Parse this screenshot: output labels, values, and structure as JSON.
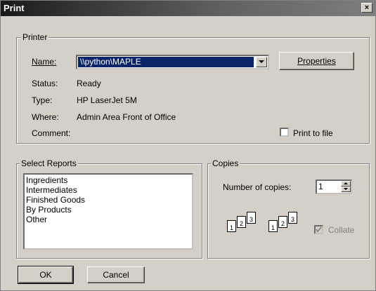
{
  "window": {
    "title": "Print",
    "close_label": "×"
  },
  "printer": {
    "legend": "Printer",
    "name_label": "Name:",
    "name_value": "\\\\python\\MAPLE",
    "properties_label": "Properties",
    "status_label": "Status:",
    "status_value": "Ready",
    "type_label": "Type:",
    "type_value": "HP LaserJet 5M",
    "where_label": "Where:",
    "where_value": "Admin Area Front of Office",
    "comment_label": "Comment:",
    "print_to_file_label": "Print to file"
  },
  "reports": {
    "legend": "Select Reports",
    "items": [
      "Ingredients",
      "Intermediates",
      "Finished Goods",
      "By Products",
      "Other"
    ]
  },
  "copies": {
    "legend": "Copies",
    "number_label": "Number of copies:",
    "number_value": "1",
    "collate_label": "Collate",
    "page_labels": [
      "1",
      "2",
      "3"
    ]
  },
  "buttons": {
    "ok": "OK",
    "cancel": "Cancel"
  }
}
